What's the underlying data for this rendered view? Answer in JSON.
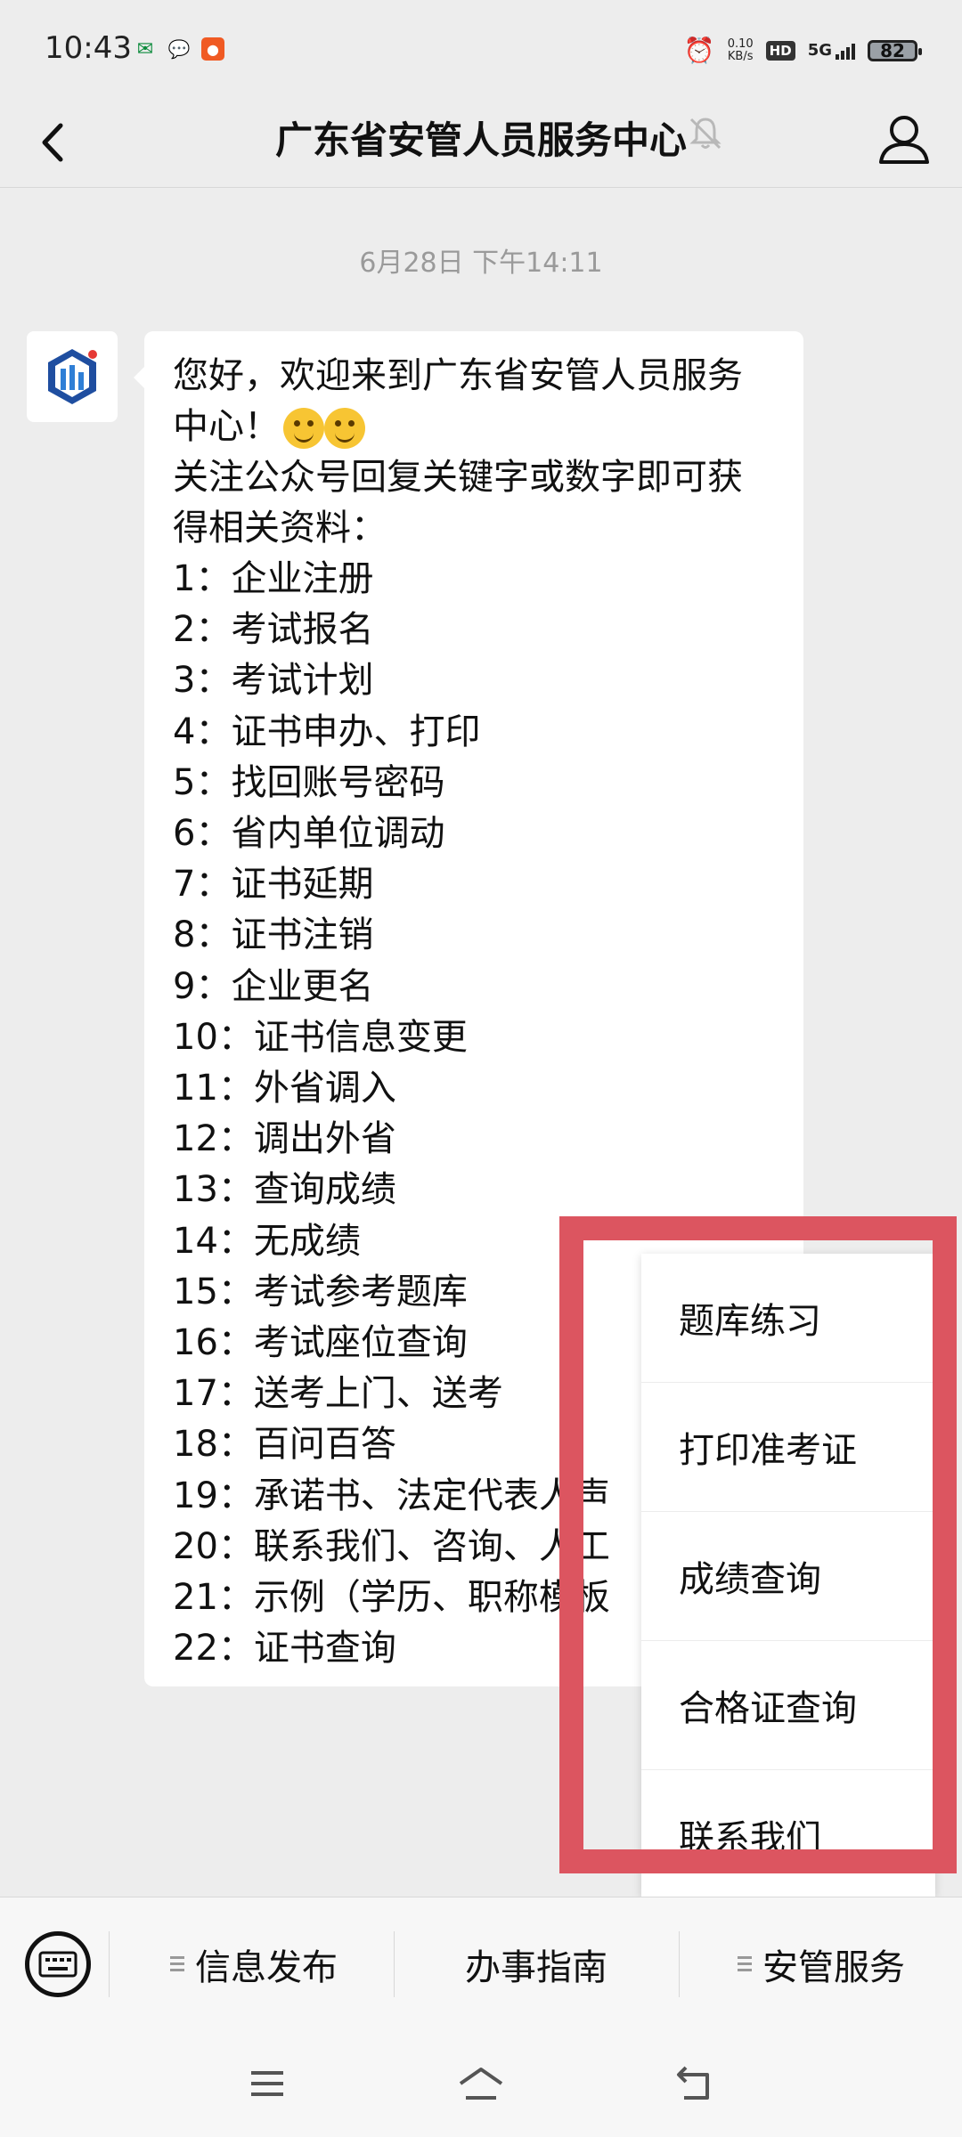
{
  "status_bar": {
    "time": "10:43",
    "net_speed": "0.10\nKB/s",
    "hd_label": "HD",
    "network": "5G",
    "battery": "82"
  },
  "header": {
    "title": "广东省安管人员服务中心"
  },
  "chat": {
    "timestamp": "6月28日 下午14:11",
    "intro_1": "您好，欢迎来到广东省安管人员服务中心！",
    "intro_2": "关注公众号回复关键字或数字即可获得相关资料：",
    "items": [
      "1：企业注册",
      "2：考试报名",
      "3：考试计划",
      "4：证书申办、打印",
      "5：找回账号密码",
      "6：省内单位调动",
      "7：证书延期",
      "8：证书注销",
      "9：企业更名",
      "10：证书信息变更",
      "11：外省调入",
      "12：调出外省",
      "13：查询成绩",
      "14：无成绩",
      "15：考试参考题库",
      "16：考试座位查询",
      "17：送考上门、送考",
      "18：百问百答",
      "19：承诺书、法定代表人声",
      "20：联系我们、咨询、人工",
      "21：示例（学历、职称模板",
      "22：证书查询"
    ]
  },
  "popup_menu": {
    "items": [
      "题库练习",
      "打印准考证",
      "成绩查询",
      "合格证查询",
      "联系我们"
    ]
  },
  "bottom_menu": {
    "tab1": "信息发布",
    "tab2": "办事指南",
    "tab3": "安管服务"
  },
  "colors": {
    "highlight": "#dc5560",
    "background": "#ededed"
  }
}
